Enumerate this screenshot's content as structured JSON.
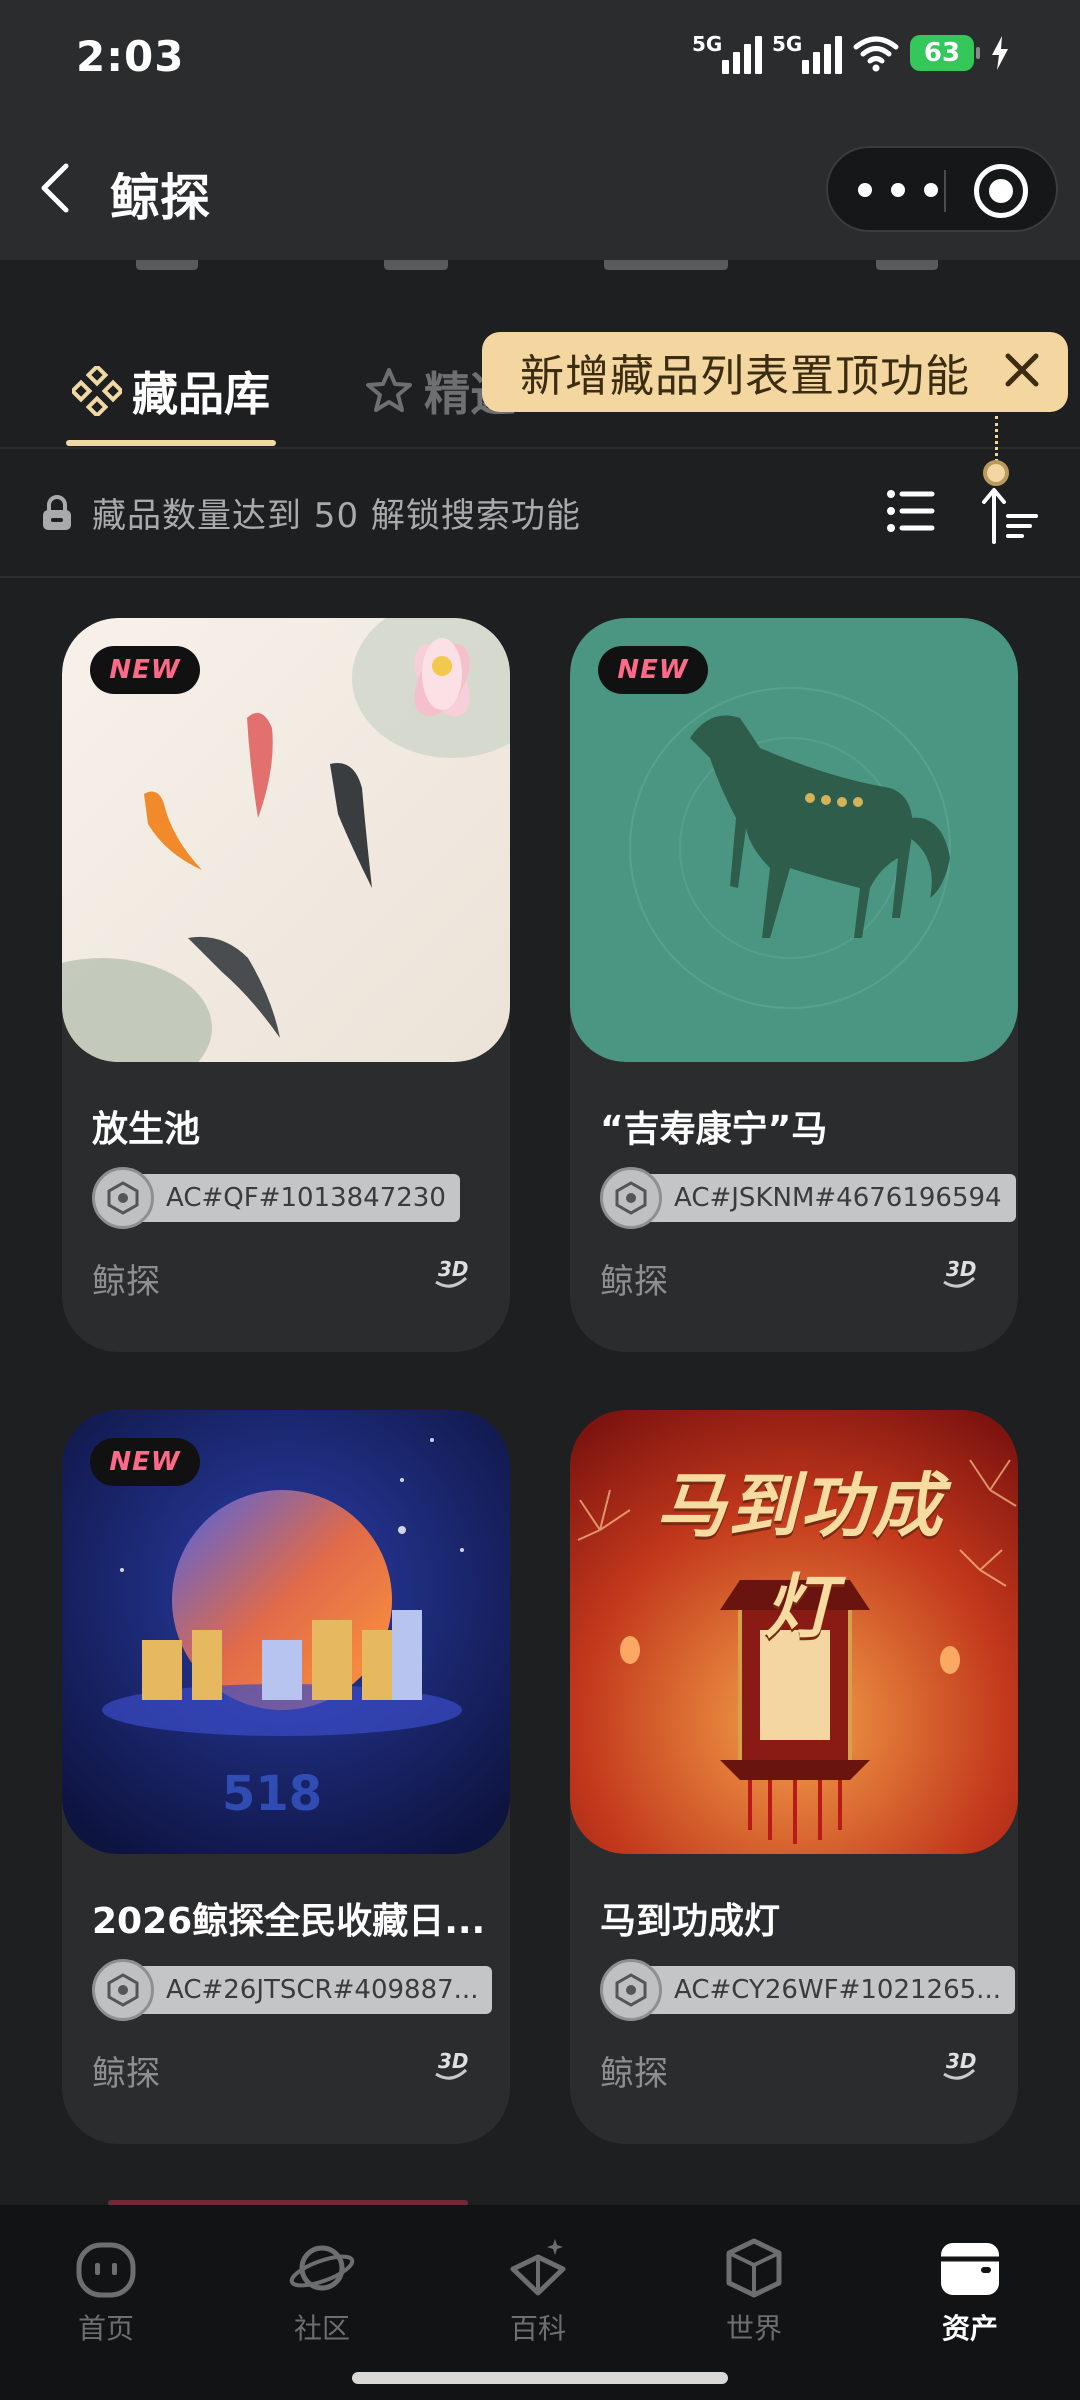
{
  "status_bar": {
    "time": "2:03",
    "network_1": "5G",
    "network_2": "5G",
    "battery": "63"
  },
  "header": {
    "title": "鲸探"
  },
  "tabs": [
    {
      "label": "藏品库"
    },
    {
      "label": "精选"
    }
  ],
  "tooltip": {
    "text": "新增藏品列表置顶功能"
  },
  "search": {
    "hint": "藏品数量达到 50 解锁搜索功能"
  },
  "cards": [
    {
      "badge": "NEW",
      "name": "放生池",
      "id": "AC#QF#1013847230",
      "source": "鲸探"
    },
    {
      "badge": "NEW",
      "name": "“吉寿康宁”马",
      "id": "AC#JSKNM#4676196594",
      "source": "鲸探"
    },
    {
      "badge": "NEW",
      "name": "2026鲸探全民收藏日...",
      "id": "AC#26JTSCR#409887...",
      "source": "鲸探"
    },
    {
      "badge": "",
      "name": "马到功成灯",
      "id": "AC#CY26WF#1021265...",
      "source": "鲸探",
      "image_title": "马到功成灯"
    }
  ],
  "bottom_nav": [
    {
      "label": "首页",
      "icon": "home-icon"
    },
    {
      "label": "社区",
      "icon": "planet-icon"
    },
    {
      "label": "百科",
      "icon": "book-icon"
    },
    {
      "label": "世界",
      "icon": "cube-icon"
    },
    {
      "label": "资产",
      "icon": "wallet-icon",
      "active": true
    }
  ],
  "colors": {
    "accent": "#f4d7a0",
    "background": "#1e1f20",
    "card": "#2b2c2e"
  }
}
